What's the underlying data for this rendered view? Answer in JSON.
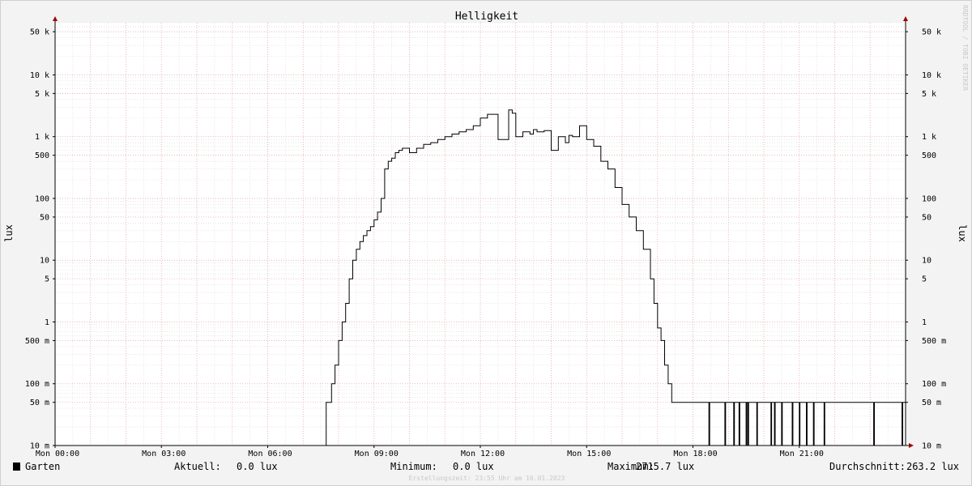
{
  "chart_data": {
    "type": "line",
    "title": "Helligkeit",
    "ylabel": "lux",
    "yscale": "log",
    "ylim": [
      0.01,
      70000
    ],
    "xlim": [
      0,
      24
    ],
    "x_tick_labels": [
      "Mon 00:00",
      "Mon 03:00",
      "Mon 06:00",
      "Mon 09:00",
      "Mon 12:00",
      "Mon 15:00",
      "Mon 18:00",
      "Mon 21:00"
    ],
    "x_tick_hours": [
      0,
      3,
      6,
      9,
      12,
      15,
      18,
      21
    ],
    "y_ticks": [
      {
        "value": 0.01,
        "label": "10 m"
      },
      {
        "value": 0.05,
        "label": "50 m"
      },
      {
        "value": 0.1,
        "label": "100 m"
      },
      {
        "value": 0.5,
        "label": "500 m"
      },
      {
        "value": 1,
        "label": "1"
      },
      {
        "value": 5,
        "label": "5"
      },
      {
        "value": 10,
        "label": "10"
      },
      {
        "value": 50,
        "label": "50"
      },
      {
        "value": 100,
        "label": "100"
      },
      {
        "value": 500,
        "label": "500"
      },
      {
        "value": 1000,
        "label": "1 k"
      },
      {
        "value": 5000,
        "label": "5 k"
      },
      {
        "value": 10000,
        "label": "10 k"
      },
      {
        "value": 50000,
        "label": "50 k"
      }
    ],
    "grid": true,
    "series": [
      {
        "name": "Garten",
        "color": "#000000",
        "x": [
          0,
          7.65,
          7.8,
          7.9,
          8.0,
          8.1,
          8.2,
          8.3,
          8.4,
          8.5,
          8.6,
          8.7,
          8.8,
          8.9,
          9.0,
          9.1,
          9.2,
          9.3,
          9.4,
          9.5,
          9.6,
          9.7,
          9.8,
          10.0,
          10.2,
          10.4,
          10.6,
          10.8,
          11.0,
          11.2,
          11.4,
          11.6,
          11.8,
          12.0,
          12.2,
          12.5,
          12.8,
          12.9,
          13.0,
          13.2,
          13.4,
          13.5,
          13.6,
          13.8,
          14.0,
          14.2,
          14.4,
          14.5,
          14.6,
          14.8,
          15.0,
          15.2,
          15.4,
          15.6,
          15.8,
          16.0,
          16.2,
          16.4,
          16.6,
          16.8,
          16.9,
          17.0,
          17.1,
          17.2,
          17.3,
          17.4,
          17.5,
          17.6,
          17.7,
          17.8,
          17.9,
          18.0,
          18.45,
          18.47,
          18.9,
          18.92,
          19.15,
          19.17,
          19.3,
          19.32,
          19.5,
          19.52,
          19.55,
          19.57,
          19.8,
          19.82,
          20.2,
          20.22,
          20.3,
          20.32,
          20.5,
          20.52,
          20.8,
          20.82,
          21.0,
          21.02,
          21.2,
          21.22,
          21.4,
          21.42,
          21.7,
          21.72,
          23.1,
          23.12,
          23.9,
          23.92,
          24.0
        ],
        "values": [
          0.01,
          0.05,
          0.1,
          0.2,
          0.5,
          1,
          2,
          5,
          10,
          15,
          20,
          25,
          30,
          35,
          45,
          60,
          100,
          300,
          400,
          450,
          550,
          600,
          650,
          550,
          650,
          750,
          800,
          900,
          1000,
          1100,
          1200,
          1300,
          1500,
          2000,
          2300,
          900,
          2700,
          2400,
          1000,
          1200,
          1100,
          1300,
          1200,
          1250,
          600,
          1000,
          800,
          1050,
          1000,
          1500,
          900,
          700,
          400,
          300,
          150,
          80,
          50,
          30,
          15,
          5,
          2,
          0.8,
          0.5,
          0.2,
          0.1,
          0.05,
          0.05,
          0.05,
          0.05,
          0.05,
          0.05,
          0.05,
          0.01,
          0.05,
          0.01,
          0.05,
          0.01,
          0.05,
          0.01,
          0.05,
          0.01,
          0.05,
          0.01,
          0.05,
          0.01,
          0.05,
          0.01,
          0.05,
          0.01,
          0.05,
          0.01,
          0.05,
          0.01,
          0.05,
          0.01,
          0.05,
          0.01,
          0.05,
          0.01,
          0.05,
          0.01,
          0.05,
          0.01,
          0.05,
          0.01,
          0.05,
          0.01
        ]
      }
    ]
  },
  "legend": {
    "series_name": "Garten",
    "current_label": "Aktuell:",
    "current_value": "0.0 lux",
    "min_label": "Minimum:",
    "min_value": "0.0 lux",
    "max_label": "Maximum:",
    "max_value": "2715.7 lux",
    "avg_label": "Durchschnitt:",
    "avg_value": "263.2 lux"
  },
  "footer": "Erstellungszeit: 23:55 Uhr am 16.01.2023",
  "watermark": "RRDTOOL / TOBI OETIKER",
  "colors": {
    "background": "#f3f3f3",
    "plot_background": "#ffffff",
    "major_grid": "#e8a0a0",
    "minor_grid": "#d8d8d8",
    "axis_arrow": "#a00000",
    "line": "#000000"
  }
}
